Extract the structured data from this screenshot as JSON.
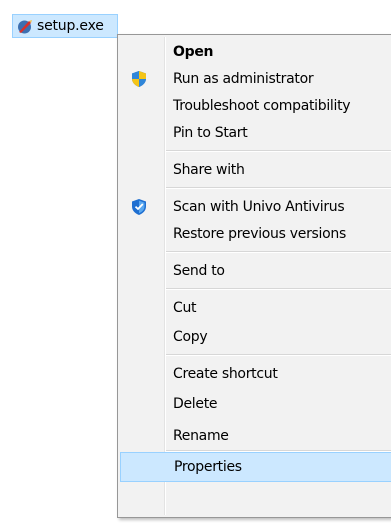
{
  "file": {
    "name": "setup.exe",
    "icon": "setup-file-icon"
  },
  "menu": {
    "open": "Open",
    "run_as_admin": "Run as administrator",
    "troubleshoot": "Troubleshoot compatibility",
    "pin_to_start": "Pin to Start",
    "share_with": "Share with",
    "scan_antivirus": "Scan with Univo Antivirus",
    "restore_versions": "Restore previous versions",
    "send_to": "Send to",
    "cut": "Cut",
    "copy": "Copy",
    "create_shortcut": "Create shortcut",
    "delete": "Delete",
    "rename": "Rename",
    "properties": "Properties"
  },
  "icons": {
    "uac": "uac-shield-icon",
    "antivirus": "antivirus-shield-icon"
  },
  "colors": {
    "highlight": "#cce8ff",
    "highlight_border": "#99d1ff",
    "menu_bg": "#f2f2f2"
  }
}
